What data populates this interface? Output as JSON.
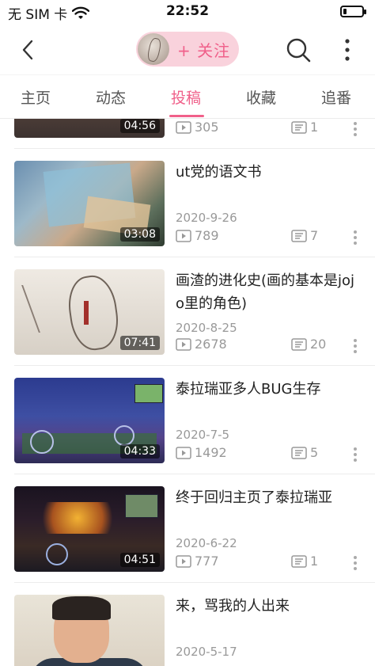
{
  "status_bar": {
    "carrier": "无 SIM 卡",
    "time": "22:52",
    "battery_level": 0.2
  },
  "nav": {
    "follow_label": "+ 关注"
  },
  "tabs": [
    {
      "label": "主页",
      "active": false
    },
    {
      "label": "动态",
      "active": false
    },
    {
      "label": "投稿",
      "active": true
    },
    {
      "label": "收藏",
      "active": false
    },
    {
      "label": "追番",
      "active": false
    }
  ],
  "videos": [
    {
      "title": "",
      "date": "",
      "duration": "04:56",
      "views": "305",
      "danmaku": "1"
    },
    {
      "title": "ut党的语文书",
      "date": "2020-9-26",
      "duration": "03:08",
      "views": "789",
      "danmaku": "7"
    },
    {
      "title": "画渣的进化史(画的基本是jojo里的角色)",
      "date": "2020-8-25",
      "duration": "07:41",
      "views": "2678",
      "danmaku": "20"
    },
    {
      "title": "泰拉瑞亚多人BUG生存",
      "date": "2020-7-5",
      "duration": "04:33",
      "views": "1492",
      "danmaku": "5"
    },
    {
      "title": "终于回归主页了泰拉瑞亚",
      "date": "2020-6-22",
      "duration": "04:51",
      "views": "777",
      "danmaku": "1"
    },
    {
      "title": "来，骂我的人出来",
      "date": "2020-5-17",
      "duration": "",
      "views": "",
      "danmaku": ""
    }
  ],
  "colors": {
    "accent": "#f0608a",
    "pill_bg": "#f9d2dc",
    "muted_text": "#999999"
  },
  "icons": [
    "back-arrow-icon",
    "search-icon",
    "more-vertical-icon",
    "play-count-icon",
    "danmaku-count-icon",
    "wifi-icon",
    "battery-icon"
  ]
}
